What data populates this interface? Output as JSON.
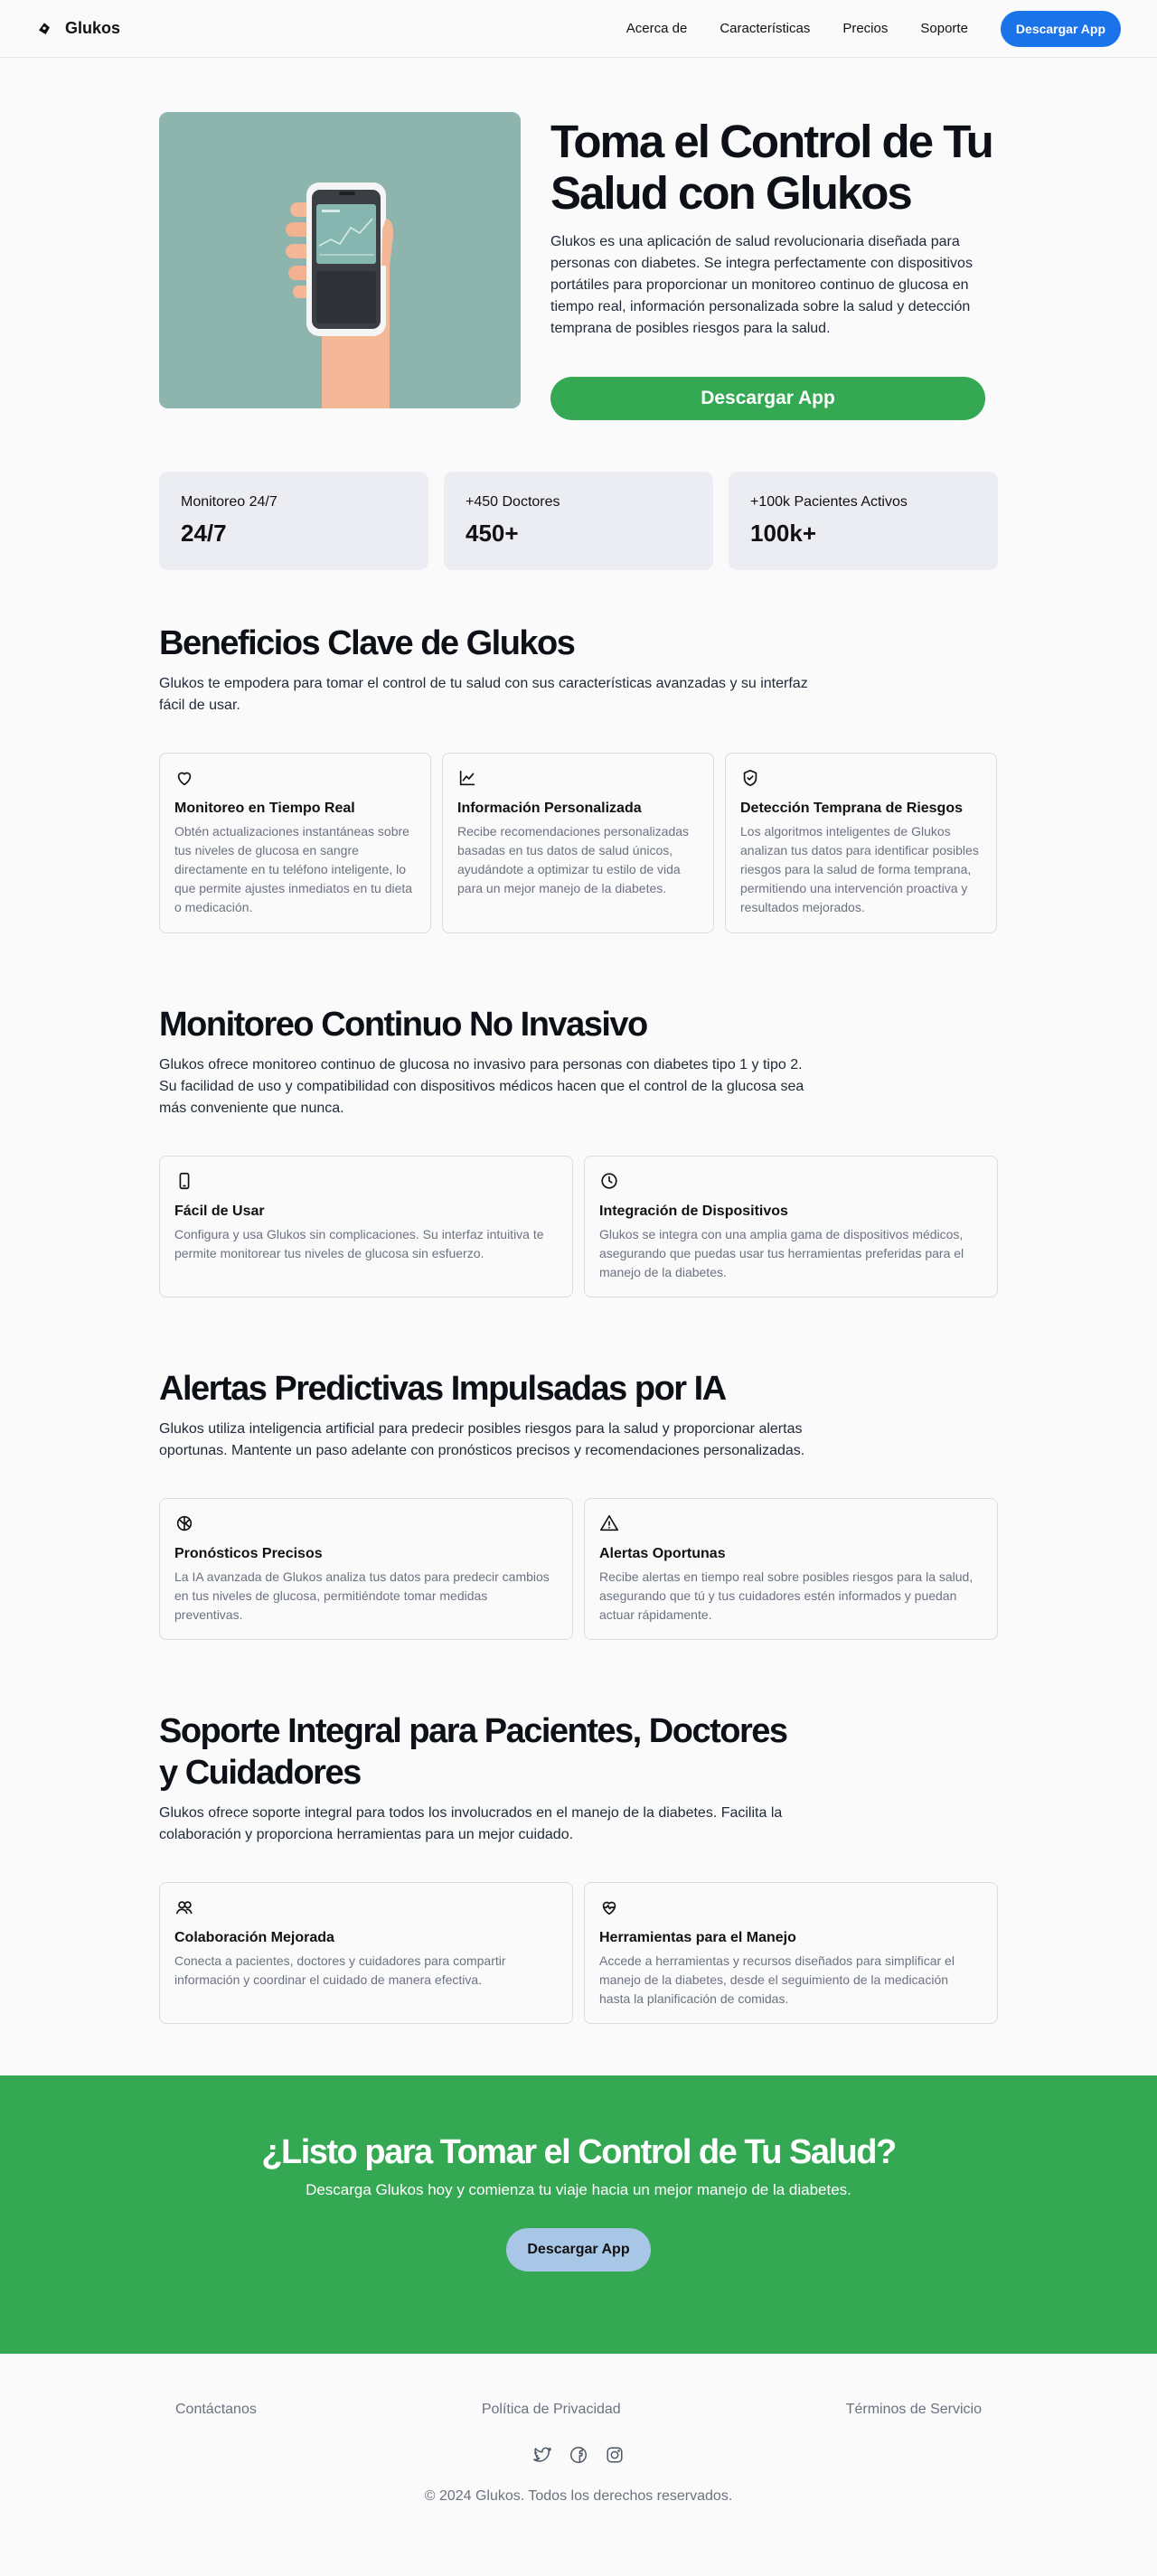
{
  "nav": {
    "brand": "Glukos",
    "links": [
      "Acerca de",
      "Características",
      "Precios",
      "Soporte"
    ],
    "cta": "Descargar App"
  },
  "hero": {
    "title": "Toma el Control de Tu Salud con Glukos",
    "description": "Glukos es una aplicación de salud revolucionaria diseñada para personas con diabetes. Se integra perfectamente con dispositivos portátiles para proporcionar un monitoreo continuo de glucosa en tiempo real, información personalizada sobre la salud y detección temprana de posibles riesgos para la salud.",
    "button": "Descargar App"
  },
  "stats": [
    {
      "label": "Monitoreo 24/7",
      "value": "24/7"
    },
    {
      "label": "+450 Doctores",
      "value": "450+"
    },
    {
      "label": "+100k Pacientes Activos",
      "value": "100k+"
    }
  ],
  "benefits": {
    "title": "Beneficios Clave de Glukos",
    "description": "Glukos te empodera para tomar el control de tu salud con sus características avanzadas y su interfaz fácil de usar.",
    "cards": [
      {
        "icon": "heart-icon",
        "title": "Monitoreo en Tiempo Real",
        "text": "Obtén actualizaciones instantáneas sobre tus niveles de glucosa en sangre directamente en tu teléfono inteligente, lo que permite ajustes inmediatos en tu dieta o medicación."
      },
      {
        "icon": "chart-line-icon",
        "title": "Información Personalizada",
        "text": "Recibe recomendaciones personalizadas basadas en tus datos de salud únicos, ayudándote a optimizar tu estilo de vida para un mejor manejo de la diabetes."
      },
      {
        "icon": "shield-check-icon",
        "title": "Detección Temprana de Riesgos",
        "text": "Los algoritmos inteligentes de Glukos analizan tus datos para identificar posibles riesgos para la salud de forma temprana, permitiendo una intervención proactiva y resultados mejorados."
      }
    ]
  },
  "monitoring": {
    "title": "Monitoreo Continuo No Invasivo",
    "description": "Glukos ofrece monitoreo continuo de glucosa no invasivo para personas con diabetes tipo 1 y tipo 2. Su facilidad de uso y compatibilidad con dispositivos médicos hacen que el control de la glucosa sea más conveniente que nunca.",
    "cards": [
      {
        "icon": "smartphone-icon",
        "title": "Fácil de Usar",
        "text": "Configura y usa Glukos sin complicaciones. Su interfaz intuitiva te permite monitorear tus niveles de glucosa sin esfuerzo."
      },
      {
        "icon": "clock-icon",
        "title": "Integración de Dispositivos",
        "text": "Glukos se integra con una amplia gama de dispositivos médicos, asegurando que puedas usar tus herramientas preferidas para el manejo de la diabetes."
      }
    ]
  },
  "alerts": {
    "title": "Alertas Predictivas Impulsadas por IA",
    "description": "Glukos utiliza inteligencia artificial para predecir posibles riesgos para la salud y proporcionar alertas oportunas. Mantente un paso adelante con pronósticos precisos y recomendaciones personalizadas.",
    "cards": [
      {
        "icon": "brain-icon",
        "title": "Pronósticos Precisos",
        "text": "La IA avanzada de Glukos analiza tus datos para predecir cambios en tus niveles de glucosa, permitiéndote tomar medidas preventivas."
      },
      {
        "icon": "alert-triangle-icon",
        "title": "Alertas Oportunas",
        "text": "Recibe alertas en tiempo real sobre posibles riesgos para la salud, asegurando que tú y tus cuidadores estén informados y puedan actuar rápidamente."
      }
    ]
  },
  "support": {
    "title": "Soporte Integral para Pacientes, Doctores y Cuidadores",
    "description": "Glukos ofrece soporte integral para todos los involucrados en el manejo de la diabetes. Facilita la colaboración y proporciona herramientas para un mejor cuidado.",
    "cards": [
      {
        "icon": "users-icon",
        "title": "Colaboración Mejorada",
        "text": "Conecta a pacientes, doctores y cuidadores para compartir información y coordinar el cuidado de manera efectiva."
      },
      {
        "icon": "heart-pulse-icon",
        "title": "Herramientas para el Manejo",
        "text": "Accede a herramientas y recursos diseñados para simplificar el manejo de la diabetes, desde el seguimiento de la medicación hasta la planificación de comidas."
      }
    ]
  },
  "cta": {
    "title": "¿Listo para Tomar el Control de Tu Salud?",
    "subtitle": "Descarga Glukos hoy y comienza tu viaje hacia un mejor manejo de la diabetes.",
    "button": "Descargar App"
  },
  "footer": {
    "links": [
      "Contáctanos",
      "Política de Privacidad",
      "Términos de Servicio"
    ],
    "socials": [
      "twitter-icon",
      "facebook-icon",
      "instagram-icon"
    ],
    "copyright": "© 2024 Glukos. Todos los derechos reservados."
  },
  "colors": {
    "accent_blue": "#1a73e8",
    "accent_green": "#34a853",
    "stat_bg": "#ebedf2",
    "hero_image_bg": "#8db4ad"
  }
}
